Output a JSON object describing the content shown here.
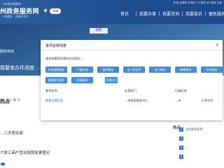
{
  "header": {
    "logo_top": "一体化在线政务",
    "site_title": "州政务服务网",
    "logo_sub": "一网通办 · 办事不求人",
    "location_label": "市辖",
    "topbar_text": "简 繁 无障碍 手机版 个人登录 法人登录 注册",
    "nav": [
      "首页",
      "我要办事",
      "我要咨询",
      "我要投诉",
      "便民服务"
    ]
  },
  "banner": {
    "tag": "搜索",
    "side_text1": "服务热线",
    "side_text2": "我要查办件进度"
  },
  "left_panel": {
    "title": "热点",
    "icons": "▤ ▦ ⊞",
    "items": [
      "…二手房交易",
      "个体工商户营业执照变更登记"
    ]
  },
  "right_panel": {
    "tag": "热点",
    "items": [
      "出生医学证明",
      "…",
      "…",
      "…"
    ]
  },
  "popup": {
    "title": "事项名称列表",
    "close": "✕",
    "subtitle": "请选择事项办理的对应地区  …",
    "services": [
      "社会保障服务",
      "户籍办理",
      "医疗服务",
      "出入境证件",
      "出行服务",
      "教育服务",
      "住房服务",
      "婚姻登记服务",
      "民政服务",
      "交通出行"
    ],
    "col_headers": [
      "事项名称",
      "办理部门",
      "行政区划"
    ],
    "col_values": [
      "查看详情信息",
      "…市政务服务中心",
      "…市",
      "办事指南"
    ]
  },
  "colors": {
    "header_bg": "#1d4c8f",
    "service_btn": "#3d8ce0",
    "link": "#2f6fd6"
  }
}
